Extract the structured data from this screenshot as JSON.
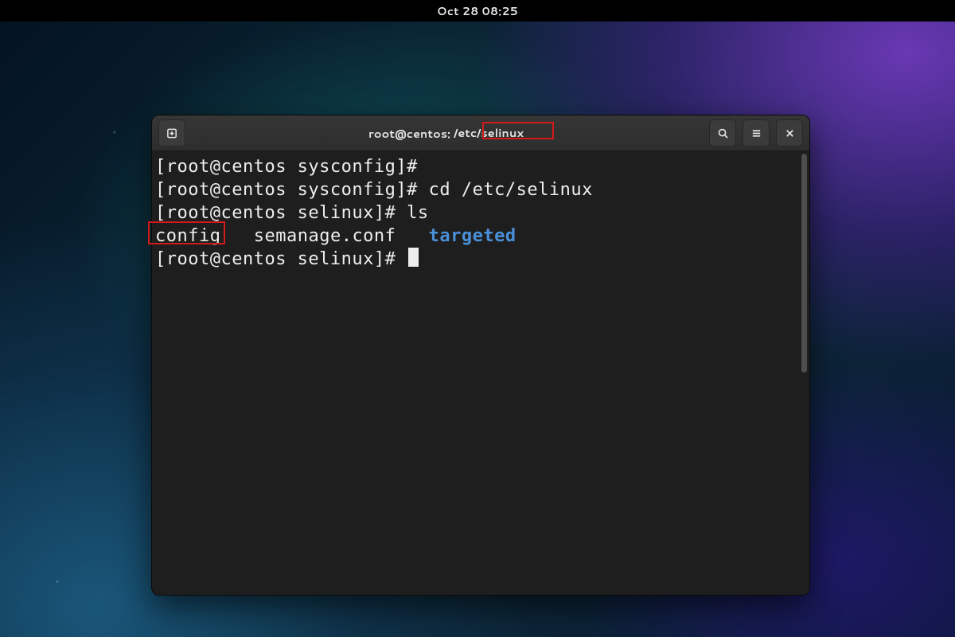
{
  "topbar": {
    "clock": "Oct 28  08:25"
  },
  "window": {
    "title_user_host": "root@centos:",
    "title_path": "/etc/selinux"
  },
  "terminal": {
    "prompt_sysconfig": "[root@centos sysconfig]# ",
    "prompt_selinux": "[root@centos selinux]# ",
    "cmd_cd": "cd /etc/selinux",
    "cmd_ls": "ls",
    "ls": {
      "config": "config",
      "semanage": "semanage.conf",
      "targeted": "targeted"
    }
  },
  "icons": {
    "new_tab": "new-tab-icon",
    "search": "search-icon",
    "menu": "hamburger-menu-icon",
    "close": "close-icon"
  },
  "colors": {
    "annotation": "#d21a1a",
    "directory": "#4a90d9",
    "term_fg": "#eeeeee",
    "term_bg": "#1e1e1e"
  }
}
